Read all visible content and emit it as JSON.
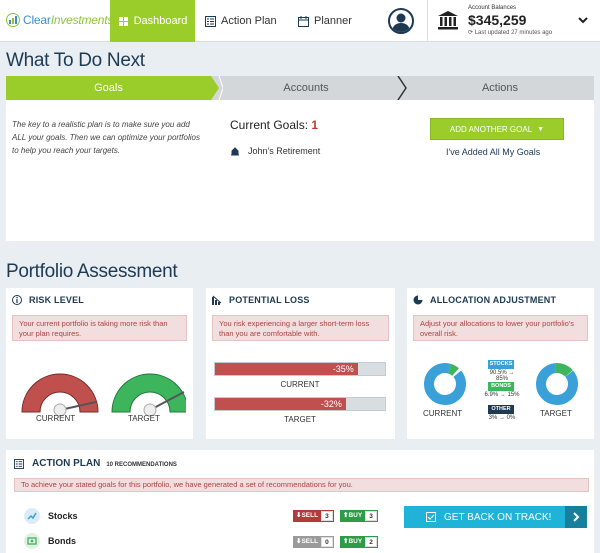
{
  "header": {
    "logo": {
      "part1": "Clear",
      "part2": "Investments"
    },
    "nav": {
      "dashboard": "Dashboard",
      "action_plan": "Action Plan",
      "planner": "Planner"
    },
    "balance": {
      "label": "Account Balances",
      "value": "$345,259",
      "updated": "Last updated 27 minutes ago"
    }
  },
  "what_next": {
    "title": "What To Do Next",
    "steps": {
      "goals": "Goals",
      "accounts": "Accounts",
      "actions": "Actions"
    },
    "intro": "The key to a realistic plan is to make sure you add ALL your goals. Then we can optimize your portfolios to help you reach your targets.",
    "current_goals_label": "Current Goals:",
    "current_goals_count": "1",
    "goals": [
      "John's Retirement"
    ],
    "add_goal_button": "ADD ANOTHER GOAL",
    "added_all_link": "I've Added All My Goals"
  },
  "assessment": {
    "title": "Portfolio Assessment",
    "risk": {
      "title": "RISK LEVEL",
      "alert": "Your current portfolio is taking more risk than your plan requires.",
      "current_label": "CURRENT",
      "target_label": "TARGET",
      "current_color": "#c0504d",
      "target_color": "#3cb55c"
    },
    "loss": {
      "title": "POTENTIAL LOSS",
      "alert": "You risk experiencing a larger short-term loss than you are comfortable with.",
      "current_value": "-35%",
      "current_fraction": 0.84,
      "current_label": "CURRENT",
      "target_value": "-32%",
      "target_fraction": 0.77,
      "target_label": "TARGET"
    },
    "alloc": {
      "title": "ALLOCATION ADJUSTMENT",
      "alert": "Adjust your allocations to lower your portfolio's overall risk.",
      "current_label": "CURRENT",
      "target_label": "TARGET",
      "stocks_tag": "STOCKS",
      "stocks_change": "90.5% → 85%",
      "bonds_tag": "BONDS",
      "bonds_change": "6.9% → 15%",
      "other_tag": "OTHER",
      "other_change": "3% → 0%"
    }
  },
  "action_plan": {
    "title": "ACTION PLAN",
    "subtitle": "10 RECOMMENDATIONS",
    "alert": "To achieve your stated goals for this portfolio, we have generated a set of recommendations for you.",
    "rows": [
      {
        "name": "Stocks",
        "sell_label": "SELL",
        "sell_count": "3",
        "buy_label": "BUY",
        "buy_count": "3"
      },
      {
        "name": "Bonds",
        "sell_label": "SELL",
        "sell_count": "0",
        "buy_label": "BUY",
        "buy_count": "2"
      }
    ],
    "track_button": "GET BACK ON TRACK!"
  }
}
